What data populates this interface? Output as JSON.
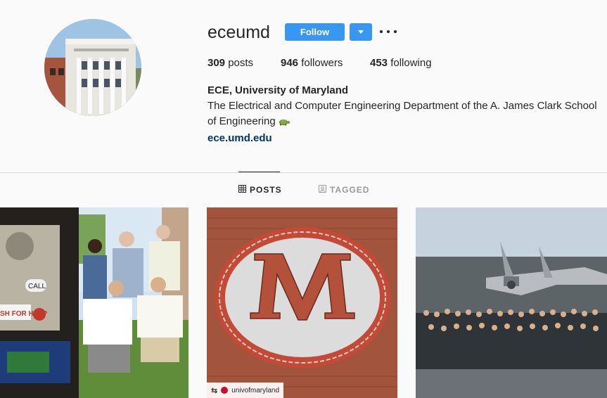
{
  "profile": {
    "username": "eceumd",
    "follow_label": "Follow",
    "stats": {
      "posts_count": "309",
      "posts_label": "posts",
      "followers_count": "946",
      "followers_label": "followers",
      "following_count": "453",
      "following_label": "following"
    },
    "full_name": "ECE, University of Maryland",
    "bio_line": "The Electrical and Computer Engineering Department of the A. James Clark School of Engineering",
    "website": "ece.umd.edu"
  },
  "tabs": [
    {
      "label": "POSTS",
      "icon": "grid-icon",
      "active": true
    },
    {
      "label": "TAGGED",
      "icon": "tag-icon",
      "active": false
    }
  ],
  "posts": [
    {
      "kind": "photo",
      "description_icon": "group-photo"
    },
    {
      "kind": "photo",
      "description_icon": "brick-m-logo",
      "repost_user": "univofmaryland"
    },
    {
      "kind": "photo",
      "description_icon": "group-photo-on-carrier"
    }
  ],
  "colors": {
    "accent": "#3897f0",
    "link": "#003569",
    "text": "#262626",
    "muted": "#999999",
    "background": "#fafafa"
  }
}
